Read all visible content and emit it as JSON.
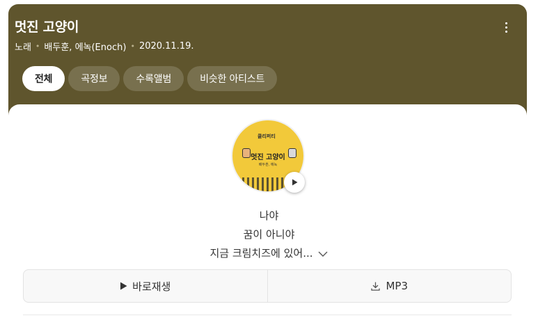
{
  "header": {
    "title": "멋진 고양이",
    "category": "노래",
    "artists": "배두훈, 에녹(Enoch)",
    "date": "2020.11.19.",
    "background_color": "#5f552d"
  },
  "tabs": [
    {
      "label": "전체",
      "active": true
    },
    {
      "label": "곡정보",
      "active": false
    },
    {
      "label": "수록앨범",
      "active": false
    },
    {
      "label": "비슷한 아티스트",
      "active": false
    }
  ],
  "album": {
    "cover_title": "멋진 고양이",
    "cover_artist": "배두훈, 에녹",
    "cover_logo": "클리퍼티",
    "cover_color": "#f2c93a"
  },
  "lyrics": {
    "lines": [
      "나야",
      "꿈이 아니야",
      "지금 크림치즈에 있어..."
    ]
  },
  "actions": {
    "play_label": "바로재생",
    "mp3_label": "MP3"
  }
}
